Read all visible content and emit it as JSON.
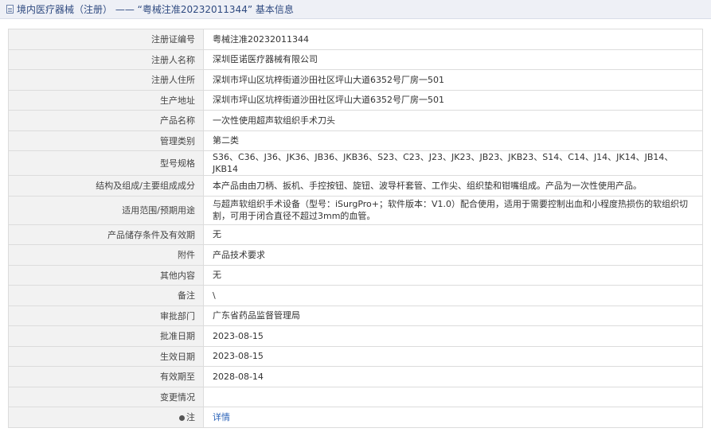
{
  "header": {
    "title": "境内医疗器械（注册） —— “粤械注准20232011344” 基本信息"
  },
  "rows": [
    {
      "label": "注册证编号",
      "value": "粤械注准20232011344"
    },
    {
      "label": "注册人名称",
      "value": "深圳臣诺医疗器械有限公司"
    },
    {
      "label": "注册人住所",
      "value": "深圳市坪山区坑梓街道沙田社区坪山大道6352号厂房一501"
    },
    {
      "label": "生产地址",
      "value": "深圳市坪山区坑梓街道沙田社区坪山大道6352号厂房一501"
    },
    {
      "label": "产品名称",
      "value": "一次性使用超声软组织手术刀头"
    },
    {
      "label": "管理类别",
      "value": "第二类"
    },
    {
      "label": "型号规格",
      "value": "S36、C36、J36、JK36、JB36、JKB36、S23、C23、J23、JK23、JB23、JKB23、S14、C14、J14、JK14、JB14、JKB14"
    },
    {
      "label": "结构及组成/主要组成成分",
      "value": "本产品由由刀柄、扳机、手控按钮、旋钮、波导杆套管、工作尖、组织垫和钳嘴组成。产品为一次性使用产品。"
    },
    {
      "label": "适用范围/预期用途",
      "value": "与超声软组织手术设备（型号：iSurgPro+；软件版本：V1.0）配合使用，适用于需要控制出血和小程度热损伤的软组织切割，可用于闭合直径不超过3mm的血管。"
    },
    {
      "label": "产品储存条件及有效期",
      "value": "无"
    },
    {
      "label": "附件",
      "value": "产品技术要求"
    },
    {
      "label": "其他内容",
      "value": "无"
    },
    {
      "label": "备注",
      "value": "\\"
    },
    {
      "label": "审批部门",
      "value": "广东省药品监督管理局"
    },
    {
      "label": "批准日期",
      "value": "2023-08-15"
    },
    {
      "label": "生效日期",
      "value": "2023-08-15"
    },
    {
      "label": "有效期至",
      "value": "2028-08-14"
    },
    {
      "label": "变更情况",
      "value": ""
    },
    {
      "label": "注",
      "value": "详情"
    }
  ]
}
